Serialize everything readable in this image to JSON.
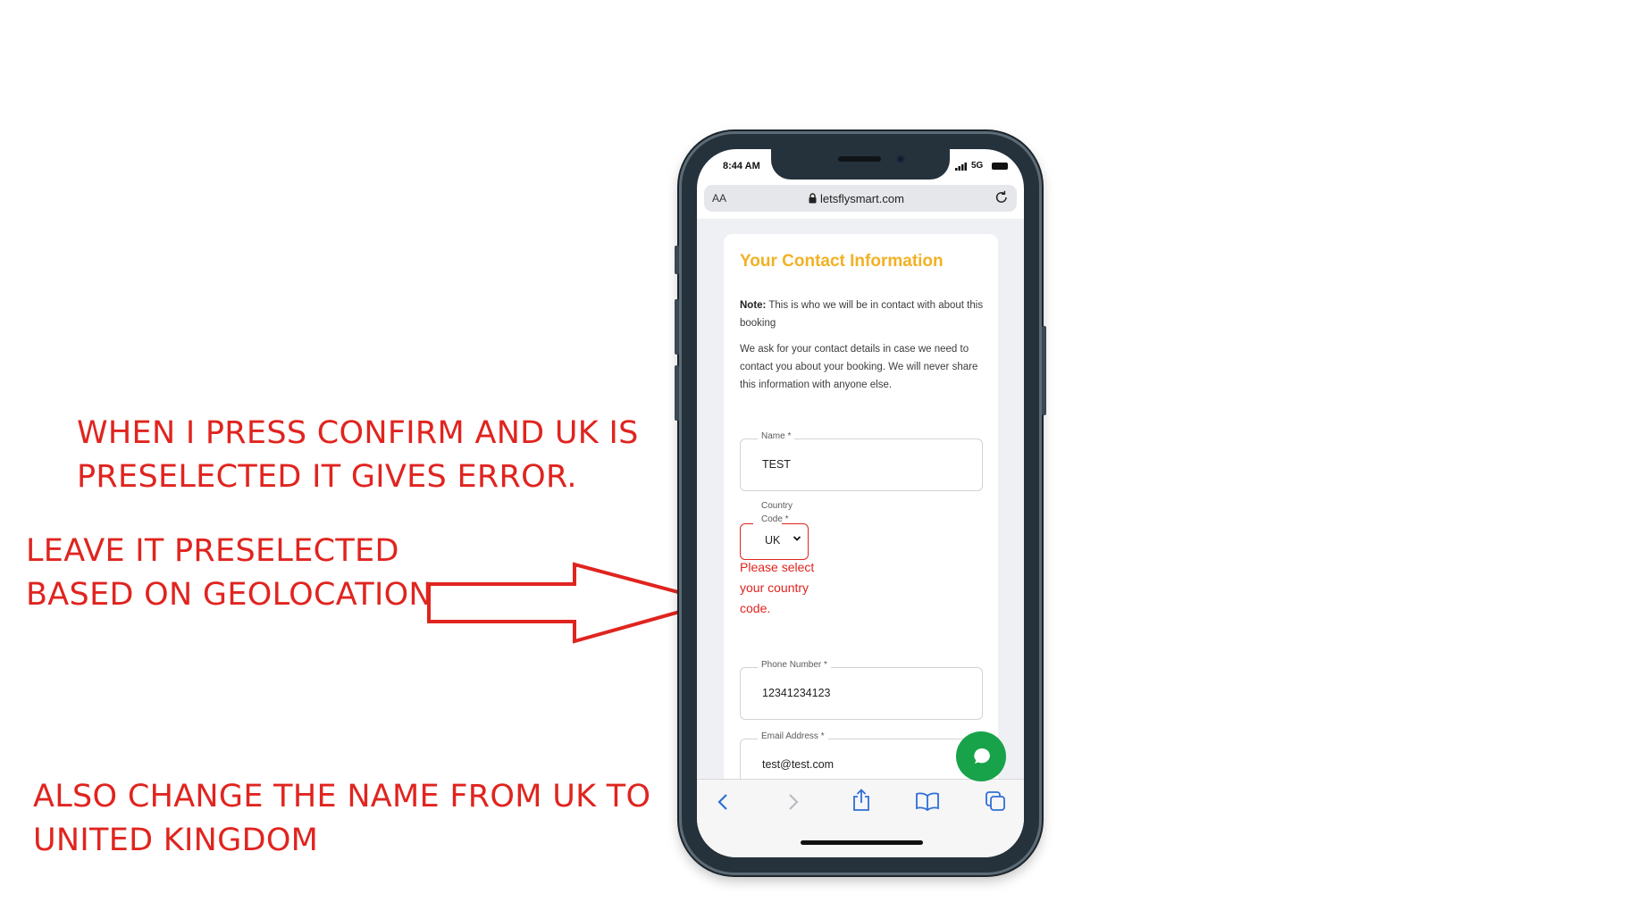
{
  "annotations": {
    "note1_lines": [
      "WHEN I PRESS CONFIRM AND UK IS",
      "PRESELECTED IT GIVES ERROR."
    ],
    "note2_lines": [
      "LEAVE IT PRESELECTED",
      "BASED ON GEOLOCATION"
    ],
    "note3_lines": [
      "ALSO CHANGE THE NAME FROM UK TO",
      "UNITED KINGDOM"
    ],
    "color": "#e0241f"
  },
  "status_bar": {
    "time": "8:44 AM",
    "network": "5G"
  },
  "browser": {
    "text_size_label": "AA",
    "url": "letsflysmart.com"
  },
  "form": {
    "title": "Your Contact Information",
    "note_label": "Note:",
    "note_text": " This is who we will be in contact with about this booking",
    "description": "We ask for your contact details in case we need to contact you about your booking. We will never share this information with anyone else.",
    "name": {
      "label": "Name *",
      "value": "TEST"
    },
    "country_code": {
      "label_line1": "Country",
      "label_line2": "Code *",
      "value": "UK",
      "error": "Please select your country code."
    },
    "phone": {
      "label": "Phone Number *",
      "value": "12341234123"
    },
    "email": {
      "label": "Email Address *",
      "value": "test@test.com"
    }
  },
  "colors": {
    "title": "#f2b124",
    "chat_button": "#18a34a",
    "error": "#e0241f"
  },
  "icons": [
    "lock-icon",
    "reload-icon",
    "chevron-down-icon",
    "chat-icon",
    "back-icon",
    "forward-icon",
    "share-icon",
    "bookmarks-icon",
    "tabs-icon"
  ]
}
